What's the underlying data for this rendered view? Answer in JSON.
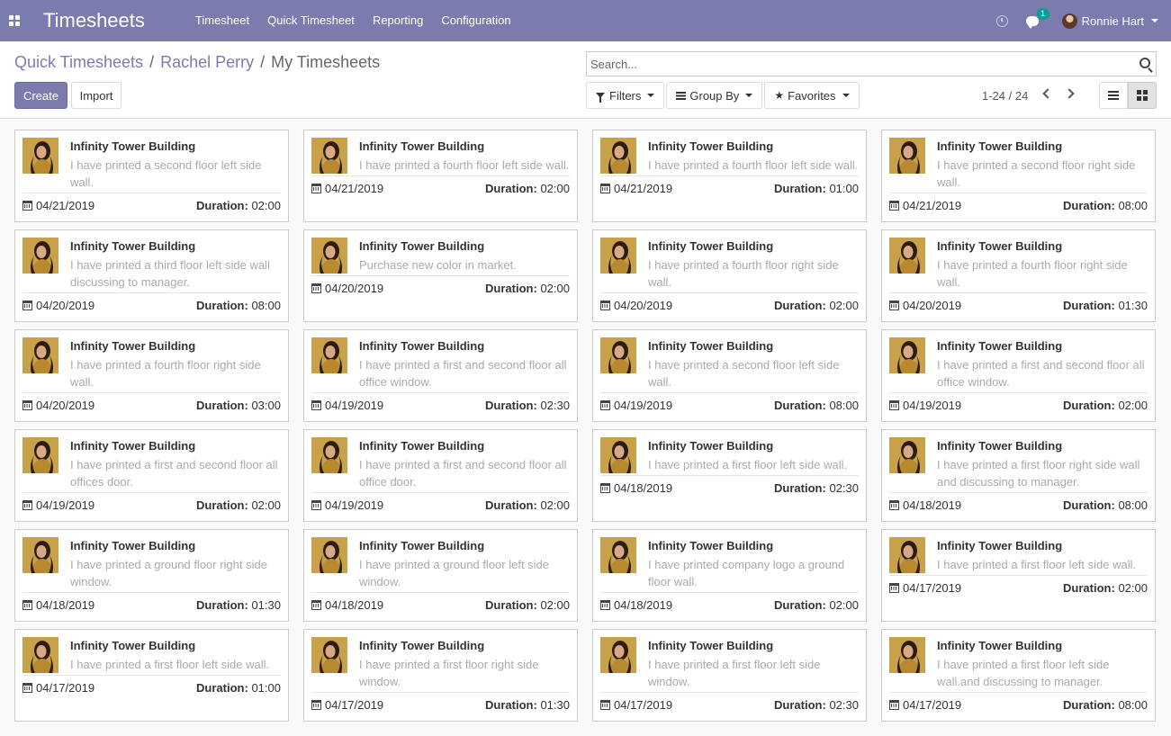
{
  "navbar": {
    "apps_icon": "grid-icon",
    "brand": "Timesheets",
    "menu": [
      "Timesheet",
      "Quick Timesheet",
      "Reporting",
      "Configuration"
    ],
    "clock_icon": "clock-icon",
    "chat_icon": "chat-icon",
    "chat_badge": "1",
    "user_name": "Ronnie Hart"
  },
  "breadcrumb": {
    "items": [
      "Quick Timesheets",
      "Rachel Perry"
    ],
    "separator": "/",
    "current": "My Timesheets"
  },
  "buttons": {
    "create": "Create",
    "import": "Import"
  },
  "search": {
    "placeholder": "Search..."
  },
  "filters": {
    "filters": "Filters",
    "group_by": "Group By",
    "favorites": "Favorites"
  },
  "pager": {
    "label": "1-24 / 24"
  },
  "card_labels": {
    "duration": "Duration:"
  },
  "cards": [
    {
      "title": "Infinity Tower Building",
      "desc": "I have printed a second floor left side wall.",
      "date": "04/21/2019",
      "duration": "02:00"
    },
    {
      "title": "Infinity Tower Building",
      "desc": "I have printed a fourth floor left side wall.",
      "date": "04/21/2019",
      "duration": "02:00"
    },
    {
      "title": "Infinity Tower Building",
      "desc": "I have printed a fourth floor left side wall.",
      "date": "04/21/2019",
      "duration": "01:00"
    },
    {
      "title": "Infinity Tower Building",
      "desc": "I have printed a second floor right side wall.",
      "date": "04/21/2019",
      "duration": "08:00"
    },
    {
      "title": "Infinity Tower Building",
      "desc": "I have printed a third floor left side wall discussing to manager.",
      "date": "04/20/2019",
      "duration": "08:00"
    },
    {
      "title": "Infinity Tower Building",
      "desc": "Purchase new color in market.",
      "date": "04/20/2019",
      "duration": "02:00"
    },
    {
      "title": "Infinity Tower Building",
      "desc": "I have printed a fourth floor right side wall.",
      "date": "04/20/2019",
      "duration": "02:00"
    },
    {
      "title": "Infinity Tower Building",
      "desc": "I have printed a fourth floor right side wall.",
      "date": "04/20/2019",
      "duration": "01:30"
    },
    {
      "title": "Infinity Tower Building",
      "desc": "I have printed a fourth floor right side wall.",
      "date": "04/20/2019",
      "duration": "03:00"
    },
    {
      "title": "Infinity Tower Building",
      "desc": "I have printed a first and second floor all office window.",
      "date": "04/19/2019",
      "duration": "02:30"
    },
    {
      "title": "Infinity Tower Building",
      "desc": "I have printed a second floor left side wall.",
      "date": "04/19/2019",
      "duration": "08:00"
    },
    {
      "title": "Infinity Tower Building",
      "desc": "I have printed a first and second floor all office window.",
      "date": "04/19/2019",
      "duration": "02:00"
    },
    {
      "title": "Infinity Tower Building",
      "desc": "I have printed a first and second floor all offices door.",
      "date": "04/19/2019",
      "duration": "02:00"
    },
    {
      "title": "Infinity Tower Building",
      "desc": "I have printed a first and second floor all office door.",
      "date": "04/19/2019",
      "duration": "02:00"
    },
    {
      "title": "Infinity Tower Building",
      "desc": "I have printed a first floor left side wall.",
      "date": "04/18/2019",
      "duration": "02:30"
    },
    {
      "title": "Infinity Tower Building",
      "desc": "I have printed a first floor right side wall and discussing to manager.",
      "date": "04/18/2019",
      "duration": "08:00"
    },
    {
      "title": "Infinity Tower Building",
      "desc": "I have printed a ground floor right side window.",
      "date": "04/18/2019",
      "duration": "01:30"
    },
    {
      "title": "Infinity Tower Building",
      "desc": "I have printed a ground floor left side window.",
      "date": "04/18/2019",
      "duration": "02:00"
    },
    {
      "title": "Infinity Tower Building",
      "desc": "I have printed company logo a ground floor wall.",
      "date": "04/18/2019",
      "duration": "02:00"
    },
    {
      "title": "Infinity Tower Building",
      "desc": "I have printed a first floor left side wall.",
      "date": "04/17/2019",
      "duration": "02:00"
    },
    {
      "title": "Infinity Tower Building",
      "desc": "I have printed a first floor left side wall.",
      "date": "04/17/2019",
      "duration": "01:00"
    },
    {
      "title": "Infinity Tower Building",
      "desc": "I have printed a first floor right side window.",
      "date": "04/17/2019",
      "duration": "01:30"
    },
    {
      "title": "Infinity Tower Building",
      "desc": "I have printed a first floor left side window.",
      "date": "04/17/2019",
      "duration": "02:30"
    },
    {
      "title": "Infinity Tower Building",
      "desc": "I have printed a first floor left side wall.and discussing to manager.",
      "date": "04/17/2019",
      "duration": "08:00"
    }
  ],
  "colors": {
    "navbar": "#7c7bad",
    "primary": "#7c7bad",
    "badge": "#00a09d"
  }
}
